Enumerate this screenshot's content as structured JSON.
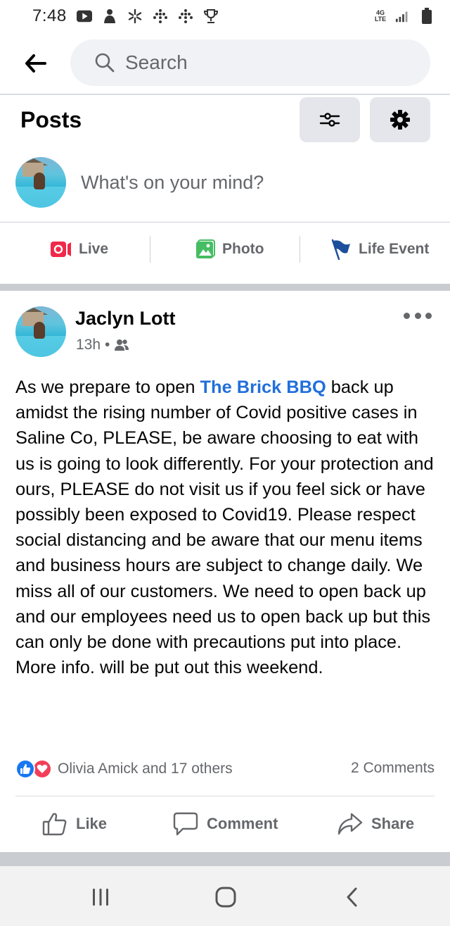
{
  "status_bar": {
    "time": "7:48",
    "icons": [
      "youtube-icon",
      "person-icon",
      "walmart-spark-icon",
      "dots-grid-icon",
      "dots-grid-icon",
      "trophy-icon"
    ],
    "network": "4G LTE",
    "signal": "signal-bars-icon",
    "battery": "battery-icon"
  },
  "search": {
    "placeholder": "Search"
  },
  "posts_header": {
    "title": "Posts",
    "filter_icon": "filter-sliders-icon",
    "settings_icon": "gear-icon"
  },
  "composer": {
    "prompt": "What's on your mind?"
  },
  "quick_actions": [
    {
      "label": "Live",
      "icon": "live-video-icon",
      "color": "#f02849"
    },
    {
      "label": "Photo",
      "icon": "photo-icon",
      "color": "#45bd62"
    },
    {
      "label": "Life Event",
      "icon": "flag-icon",
      "color": "#1b4f9c"
    }
  ],
  "post": {
    "author": "Jaclyn Lott",
    "time": "13h",
    "separator": "•",
    "audience_icon": "friends-icon",
    "body_before": "As we prepare to open ",
    "mention": "The Brick BBQ",
    "body_after": " back up amidst the rising number of Covid positive cases in Saline Co, PLEASE, be aware choosing to eat with us is going to look differently. For your protection and ours, PLEASE do not visit us if you feel sick or have possibly been exposed to Covid19. Please respect social distancing and be aware that our menu items and business hours are subject to change daily. We miss all of our customers. We need to open back up and our employees need us to open back up but this can only be done with precautions put into place.  More info. will be put out this weekend.",
    "reactions_text": "Olivia Amick and 17 others",
    "comments_text": "2 Comments",
    "actions": [
      {
        "label": "Like",
        "icon": "thumbs-up-icon"
      },
      {
        "label": "Comment",
        "icon": "comment-bubble-icon"
      },
      {
        "label": "Share",
        "icon": "share-arrow-icon"
      }
    ]
  },
  "colors": {
    "link": "#216fdb",
    "secondary_text": "#65676b",
    "like_blue": "#1877f2",
    "love_red": "#f33e58",
    "band_gray": "#c9ccd1"
  },
  "nav_bar": {
    "buttons": [
      "recents-icon",
      "home-icon",
      "back-icon"
    ]
  }
}
